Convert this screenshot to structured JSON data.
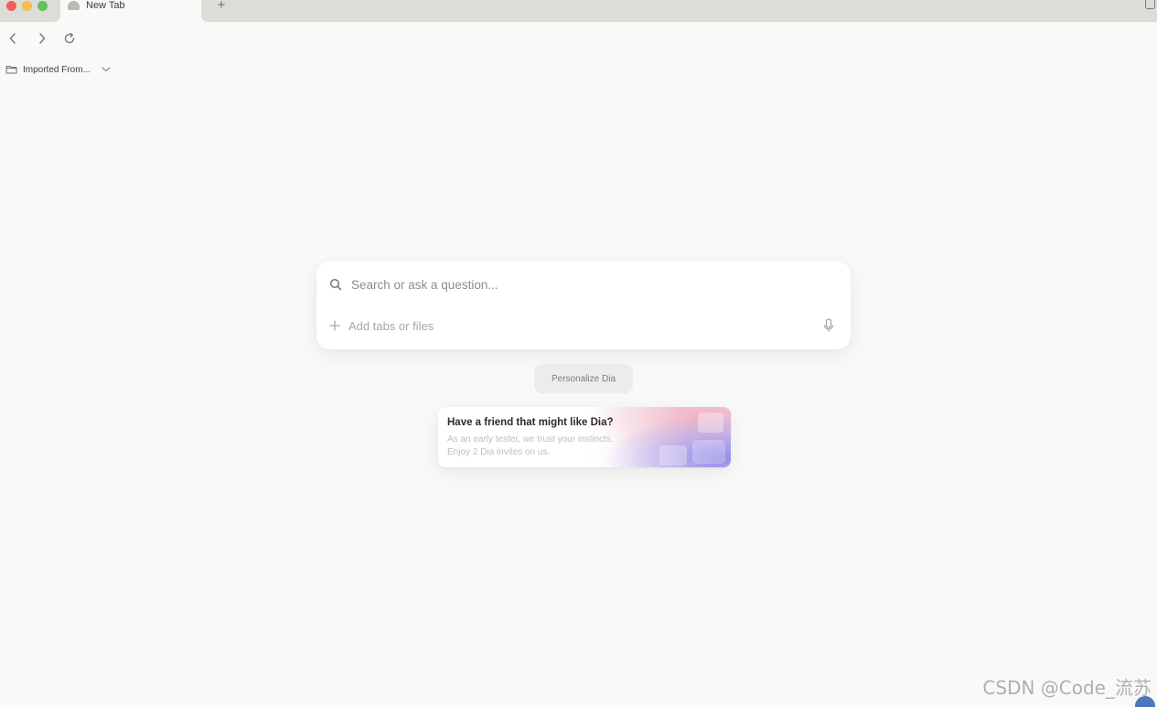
{
  "tabs": [
    {
      "title": "New Tab",
      "active": true,
      "icon": "globe-icon"
    }
  ],
  "toolbar": {
    "back_icon": "chevron-left-icon",
    "forward_icon": "chevron-right-icon",
    "reload_icon": "reload-icon"
  },
  "bookmarks": {
    "items": [
      {
        "label": "Imported From...",
        "icon": "folder-icon",
        "has_dropdown": true
      }
    ]
  },
  "search": {
    "placeholder": "Search or ask a question...",
    "value": "",
    "attach_label": "Add tabs or files",
    "icons": [
      "search-icon",
      "plus-icon",
      "microphone-icon"
    ]
  },
  "personalize": {
    "label": "Personalize Dia"
  },
  "invite": {
    "title": "Have a friend that might like Dia?",
    "body_line1": "As an early tester, we trust your instincts.",
    "body_line2": "Enjoy 2 Dia invites on us."
  },
  "watermark": "CSDN @Code_流苏",
  "colors": {
    "background": "#f9f9f8",
    "tabstrip": "#dcdcd9",
    "traffic_close": "#ee5f57",
    "traffic_minimize": "#f5bd4f",
    "traffic_maximize": "#5fc454",
    "card_gradient_accent": "#8c8ae6"
  }
}
